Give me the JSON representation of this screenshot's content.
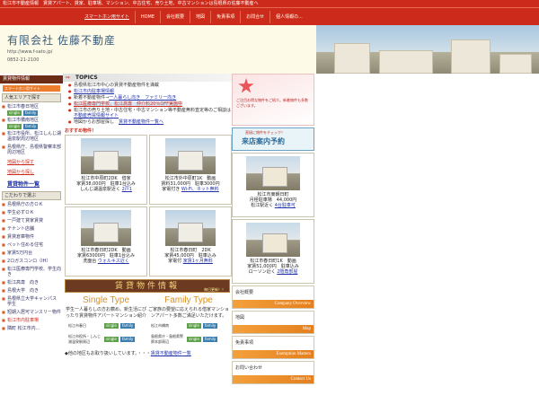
{
  "ticker": "松江市不動産情報　賃貸アパート、貸家、駐車場、マンション、中古住宅、売り土地、中古マンションは島根県の佐藤不動産へ",
  "nav": [
    "スマートホン用サイト",
    "HOME",
    "会社概要",
    "地図",
    "免責事項",
    "お問合せ",
    "個人情報の..."
  ],
  "header": {
    "company": "有限会社 佐藤不動産",
    "url": "http://www.f-sato.jp/",
    "tel": "0852-21-2100"
  },
  "sidebar": {
    "head": "賃貸物件情報",
    "smart": "スマートホン用サイト",
    "area_section": "人気エリアで探す",
    "areas": [
      {
        "label": "松江市春日地区",
        "tags": [
          "single",
          "family"
        ]
      },
      {
        "label": "松江市橋南地区",
        "tags": [
          "single",
          "family"
        ]
      },
      {
        "label": "松江市役所、松江しんじ湖温泉駅周辺地区",
        "tags": []
      },
      {
        "label": "島根県庁、島根県警察本部周辺地区",
        "tags": []
      }
    ],
    "link_red": "地図から探す",
    "link_red2": "地図から探し",
    "link_list": "賃貸物件一覧",
    "pref_section": "こだわりで選ぶ",
    "prefs": [
      "島根県庁の方ＯＫ",
      "学生必ずＯＫ",
      "一戸建て貸家賃貸",
      "テナント店舗",
      "賃貸倉庫物件",
      "ペット住める住宅",
      "家賃5万円台",
      "2ロガスコンロ（IH）",
      "松江医療専門学校、学生向き",
      "松江高専　向き",
      "島根大学　向き",
      "島根県立大学キャンパス　学生",
      "短期入居可マンスリー物件",
      "松江市内駐車場",
      "隣町 松江市内..."
    ]
  },
  "topics": {
    "head": "TOPICS",
    "items": [
      {
        "pre": "島根県松江市中心の賃貸不動産物件を満載",
        "link": "",
        "post": ""
      },
      {
        "pre": "",
        "link": "松江市内駐車場情報",
        "post": ""
      },
      {
        "pre": "新着不動産物件→",
        "link": "一人暮らし向き　ファミリー向き",
        "post": ""
      },
      {
        "pre": "",
        "link": "松江医療専門学校、松江高専　仲介料20％OFF実施中",
        "post": ""
      },
      {
        "pre": "松江市の売り土地・中古住宅・中古マンション等不動産無料査定等のご相談は",
        "link": "不動産売買情報サイト",
        "post": ""
      },
      {
        "pre": "地図からお部屋探し　",
        "link": "賃貸不動産物件一覧へ",
        "post": ""
      }
    ]
  },
  "recommend_label": "おすすめ物件！",
  "properties": [
    {
      "l1": "松江市中原町2DK　借家",
      "l2": "家賃38,000円　駐車1台込み",
      "l3": "しんじ湖温泉駅近く",
      "l3_link": "2戸1"
    },
    {
      "l1": "松江市外中原町1K　動画",
      "l2": "賃料31,000円　駐車3000円",
      "l3": "家電付き",
      "l3_link": "Wi-Fi、ネット無料"
    },
    {
      "l1": "松江市春日町2DK　動画",
      "l2": "家賃63000円　駐車1台込み",
      "l3": "洗面台",
      "l3_link": "ウォルキス近く"
    },
    {
      "l1": "松江市春日町　2DK",
      "l2": "家賃45,000円　駐車込み",
      "l3": "家電付",
      "l3_link": "家賃1ヶ月無料"
    }
  ],
  "banner": {
    "title": "賃貸物件情報",
    "sub": "毎日更新！！"
  },
  "types": [
    {
      "title": "Single Type",
      "desc": "学生一人暮らしの方お薦め。新生活にぴったり賃貸物件アパートマンション紹介"
    },
    {
      "title": "Family Type",
      "desc": "ご家族の要望に応えられる借家マンションアパート多数ご満足いただけます。"
    }
  ],
  "categories": [
    {
      "label": "松江市春日",
      "tags": [
        "single",
        "family"
      ]
    },
    {
      "label": "松江市橋南",
      "tags": [
        "single",
        "family"
      ]
    },
    {
      "label": "松江市役所・しんじ湖温泉駅周辺",
      "tags": [
        "single",
        "family"
      ]
    },
    {
      "label": "島根県庁・島根県警察本部周辺",
      "tags": [
        "single",
        "family"
      ]
    }
  ],
  "footer": {
    "pre": "◆他の地区もお取り扱いしています。・・・",
    "link": "賃貸不動産物件一覧"
  },
  "right": {
    "banner1": "ご注目お得な物件をご紹介。新着物件も多数ございます。",
    "banner2_t1": "直接に物件をチェック！",
    "banner2_t2": "来店案内予約",
    "prop1": {
      "l1": "松江市東朝日町",
      "l2": "月極駐車場　44,000円",
      "l3": "松江駅近く",
      "l3_link": "4台駐車可"
    },
    "prop2": {
      "l1": "松江市春日町1K　動画",
      "l2": "家賃51,000円　駐車込み",
      "l3": "ローソン近く",
      "l3_link": "2階角部屋"
    },
    "boxes": [
      {
        "label": "会社概要",
        "bar": "Company Overview"
      },
      {
        "label": "地図",
        "bar": "Map"
      },
      {
        "label": "免責事項",
        "bar": "Exemption Matters"
      },
      {
        "label": "お問い合わせ",
        "bar": "Contact Us"
      }
    ]
  }
}
